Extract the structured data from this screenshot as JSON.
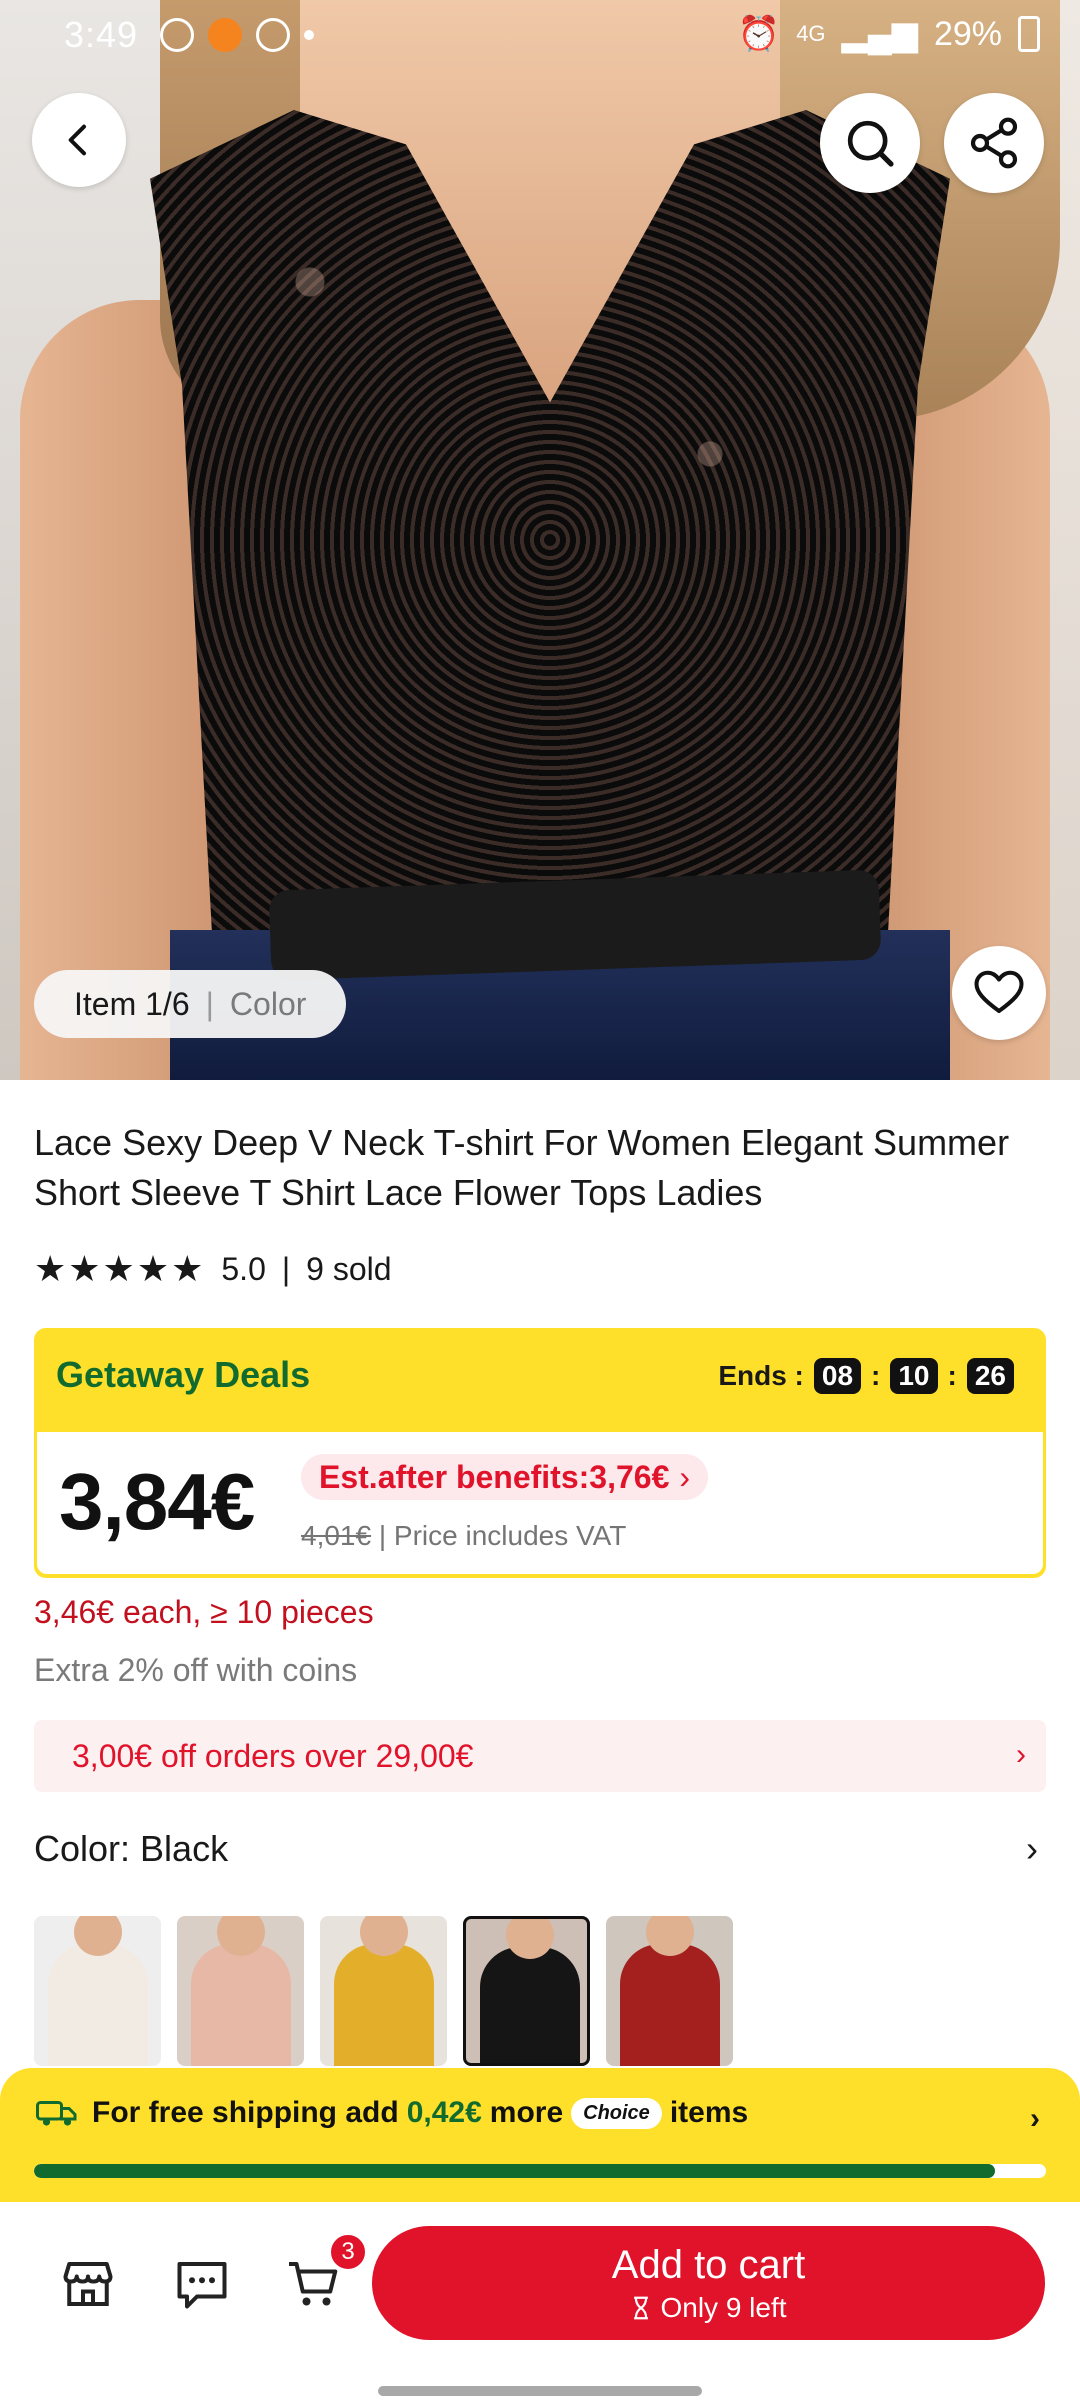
{
  "status_bar": {
    "time": "3:49",
    "network": "4G",
    "battery": "29%"
  },
  "gallery": {
    "item_counter": "Item 1/6",
    "color_tab": "Color"
  },
  "product": {
    "title": "Lace Sexy Deep V Neck T-shirt For Women Elegant Summer Short Sleeve T Shirt Lace Flower  Tops Ladies",
    "rating": "5.0",
    "sold": "9 sold",
    "stars": 5
  },
  "deal": {
    "label": "Getaway Deals",
    "ends_label": "Ends :",
    "hours": "08",
    "minutes": "10",
    "seconds": "26",
    "price": "3,84€",
    "benefits": "Est.after benefits:3,76€",
    "original_price": "4,01€",
    "vat_note": "Price includes VAT"
  },
  "bulk_offer": "3,46€ each, ≥ 10 pieces",
  "coins_offer": "Extra 2% off with coins",
  "coupon": "3,00€ off orders over 29,00€",
  "color_selector": {
    "label": "Color: Black"
  },
  "swatches": [
    {
      "name": "White",
      "color": "#f1ebe3"
    },
    {
      "name": "Pink",
      "color": "#e7b8a6"
    },
    {
      "name": "Yellow",
      "color": "#e3ae2a"
    },
    {
      "name": "Black",
      "color": "#151515",
      "selected": true
    },
    {
      "name": "Red",
      "color": "#a3201f"
    }
  ],
  "shipping": {
    "prefix": "For free shipping add",
    "amount": "0,42€",
    "middle": "more",
    "choice": "Choice",
    "suffix": "items",
    "progress_percent": 95
  },
  "bottom_bar": {
    "cart_count": "3",
    "add_to_cart": "Add to cart",
    "stock": "Only 9 left"
  },
  "colors": {
    "accent_red": "#e1132a",
    "deal_yellow": "#fee02a",
    "deal_green": "#116b2f"
  },
  "icons": [
    "back-arrow-icon",
    "search-icon",
    "share-icon",
    "heart-icon",
    "star-icon",
    "chevron-right-icon",
    "truck-icon",
    "store-icon",
    "chat-icon",
    "cart-icon",
    "hourglass-icon"
  ]
}
